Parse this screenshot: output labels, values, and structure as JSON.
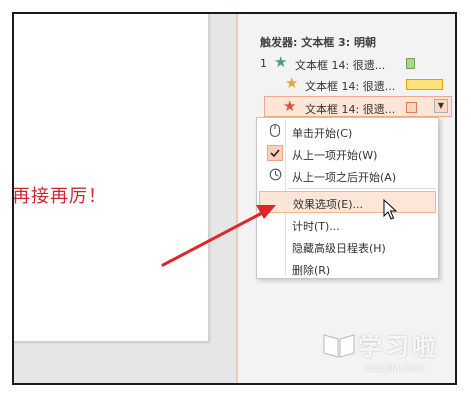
{
  "slide": {
    "text": "再接再厉！"
  },
  "animation_pane": {
    "trigger_label": "触发器: 文本框 3: 明朝",
    "items": [
      {
        "number": "1",
        "label": "文本框 14: 很遗...",
        "star_icon": "green-star-icon",
        "star_color": "#4e9a8f",
        "bar_color": "#a6d78b",
        "bar_border": "#6aa84f",
        "selected": false
      },
      {
        "number": "",
        "label": "文本框 14: 很遗...",
        "star_icon": "gold-star-icon",
        "star_color": "#e6a23c",
        "bar_color": "#ffe27a",
        "bar_border": "#d9a400",
        "selected": false
      },
      {
        "number": "",
        "label": "文本框 14: 很遗...",
        "star_icon": "red-star-icon",
        "star_color": "#d9503f",
        "bar_color": "#fbd4c0",
        "bar_border": "#e07a5f",
        "selected": true,
        "dropdown_glyph": "▼"
      }
    ]
  },
  "context_menu": {
    "items": [
      {
        "label": "单击开始(C)",
        "icon": "mouse-icon"
      },
      {
        "label": "从上一项开始(W)",
        "icon": "checkmark-icon",
        "checked": true
      },
      {
        "label": "从上一项之后开始(A)",
        "icon": "clock-icon"
      },
      {
        "label": "效果选项(E)...",
        "highlighted": true
      },
      {
        "label": "计时(T)..."
      },
      {
        "label": "隐藏高级日程表(H)"
      },
      {
        "label": "删除(R)"
      }
    ]
  },
  "watermark": {
    "text": "学习啦",
    "subtext": "xuexila.com"
  },
  "colors": {
    "accent": "#f2a98a",
    "highlight": "#fde6d7",
    "annotation_arrow": "#e0252a"
  }
}
